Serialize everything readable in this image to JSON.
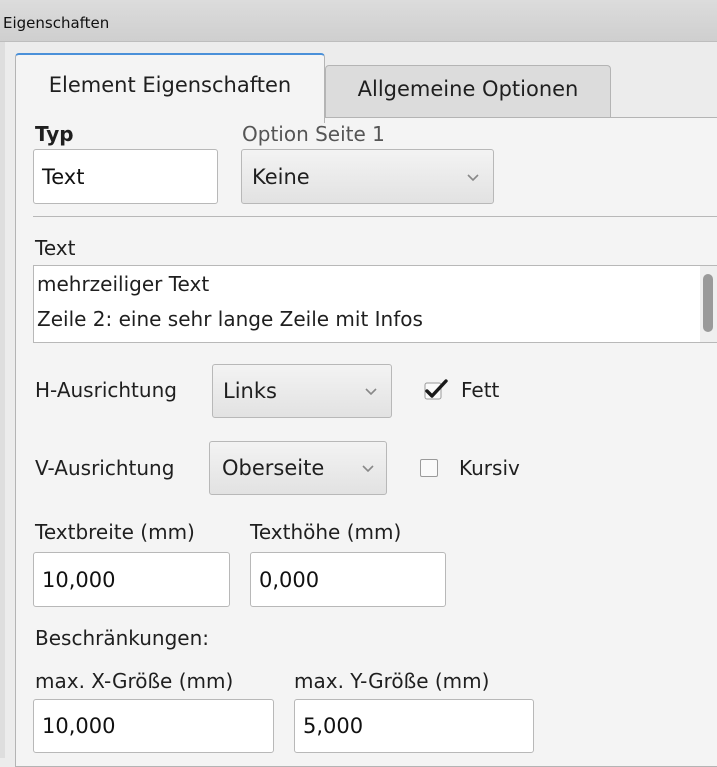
{
  "window": {
    "title": "Eigenschaften"
  },
  "tabs": [
    {
      "label": "Element Eigenschaften",
      "active": true
    },
    {
      "label": "Allgemeine Optionen",
      "active": false
    }
  ],
  "typ": {
    "label": "Typ",
    "value": "Text"
  },
  "option": {
    "label": "Option Seite 1",
    "selected": "Keine"
  },
  "text_section": {
    "label": "Text",
    "lines": [
      "mehrzeiliger Text",
      "Zeile 2: eine sehr lange Zeile mit Infos"
    ]
  },
  "h_ausrichtung": {
    "label": "H-Ausrichtung",
    "selected": "Links"
  },
  "fett": {
    "label": "Fett",
    "checked": true
  },
  "v_ausrichtung": {
    "label": "V-Ausrichtung",
    "selected": "Oberseite"
  },
  "kursiv": {
    "label": "Kursiv",
    "checked": false
  },
  "textbreite": {
    "label": "Textbreite (mm)",
    "value": "10,000"
  },
  "texthoehe": {
    "label": "Texthöhe (mm)",
    "value": "0,000"
  },
  "beschraenkungen": {
    "label": "Beschränkungen:"
  },
  "max_x": {
    "label": "max. X-Größe (mm)",
    "value": "10,000"
  },
  "max_y": {
    "label": "max. Y-Größe (mm)",
    "value": "5,000"
  },
  "colors": {
    "accent": "#4a90d9",
    "panel": "#f4f4f4",
    "border": "#b4b4b4"
  }
}
